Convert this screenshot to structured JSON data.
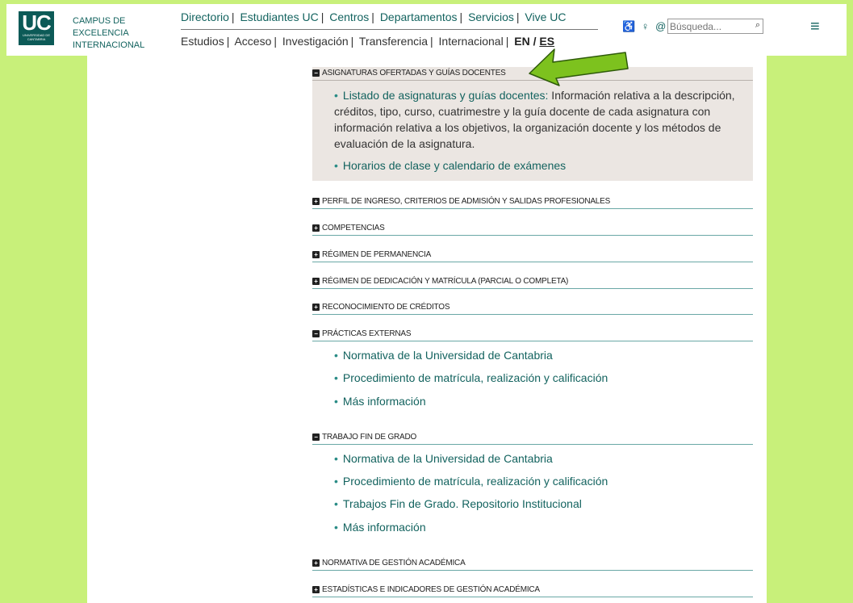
{
  "header": {
    "logo_text": "UC",
    "logo_sub": "UNIVERSIDAD DE CANTABRIA",
    "campus": [
      "CAMPUS DE",
      "EXCELENCIA",
      "INTERNACIONAL"
    ],
    "nav_top": [
      "Directorio",
      "Estudiantes UC",
      "Centros",
      "Departamentos",
      "Servicios",
      "Vive UC"
    ],
    "nav_bottom": [
      "Estudios",
      "Acceso",
      "Investigación",
      "Transferencia",
      "Internacional"
    ],
    "lang_en": "EN",
    "lang_es": "ES",
    "access_icons": "♿ ♀ @",
    "search_placeholder": "Búsqueda...",
    "colors": {
      "brand": "#13635f",
      "page_bg": "#c8f07a"
    }
  },
  "sections": {
    "asignaturas": {
      "title": "ASIGNATURAS OFERTADAS Y GUÍAS DOCENTES",
      "state": "expanded",
      "items": [
        {
          "link": "Listado de asignaturas y guías docentes:",
          "desc": " Información relativa a la descripción, créditos, tipo, curso, cuatrimestre y la guía docente de cada asignatura con información relativa a los objetivos, la organización docente y los métodos de evaluación de la asignatura."
        },
        {
          "link": "Horarios de clase y calendario de exámenes"
        }
      ]
    },
    "perfil": {
      "title": "PERFIL DE INGRESO, CRITERIOS DE ADMISIÓN Y SALIDAS PROFESIONALES",
      "state": "collapsed"
    },
    "competencias": {
      "title": "COMPETENCIAS",
      "state": "collapsed"
    },
    "permanencia": {
      "title": "RÉGIMEN DE PERMANENCIA",
      "state": "collapsed"
    },
    "dedicacion": {
      "title": "RÉGIMEN DE DEDICACIÓN Y MATRÍCULA (PARCIAL O COMPLETA)",
      "state": "collapsed"
    },
    "reconocimiento": {
      "title": "RECONOCIMIENTO DE CRÉDITOS",
      "state": "collapsed"
    },
    "practicas": {
      "title": "PRÁCTICAS EXTERNAS",
      "state": "expanded",
      "items": [
        "Normativa de la Universidad de Cantabria",
        "Procedimiento de matrícula, realización y calificación",
        "Más información"
      ]
    },
    "tfg": {
      "title": "TRABAJO FIN DE GRADO",
      "state": "expanded",
      "items": [
        "Normativa de la Universidad de Cantabria",
        "Procedimiento de matrícula, realización y calificación",
        "Trabajos Fin de Grado. Repositorio Institucional",
        "Más información"
      ]
    },
    "normativa": {
      "title": "NORMATIVA DE GESTIÓN ACADÉMICA",
      "state": "collapsed"
    },
    "estadisticas": {
      "title": "ESTADÍSTICAS E INDICADORES DE GESTIÓN ACADÉMICA",
      "state": "collapsed"
    }
  },
  "icons": {
    "expanded": "minus-box-icon",
    "collapsed": "plus-box-icon",
    "pointer": "green-arrow-icon"
  },
  "symbols": {
    "minus": "−",
    "plus": "+",
    "bullet": "•",
    "sep": "|",
    "slash": "/",
    "magnifier": "⌕",
    "menu": "≡"
  }
}
